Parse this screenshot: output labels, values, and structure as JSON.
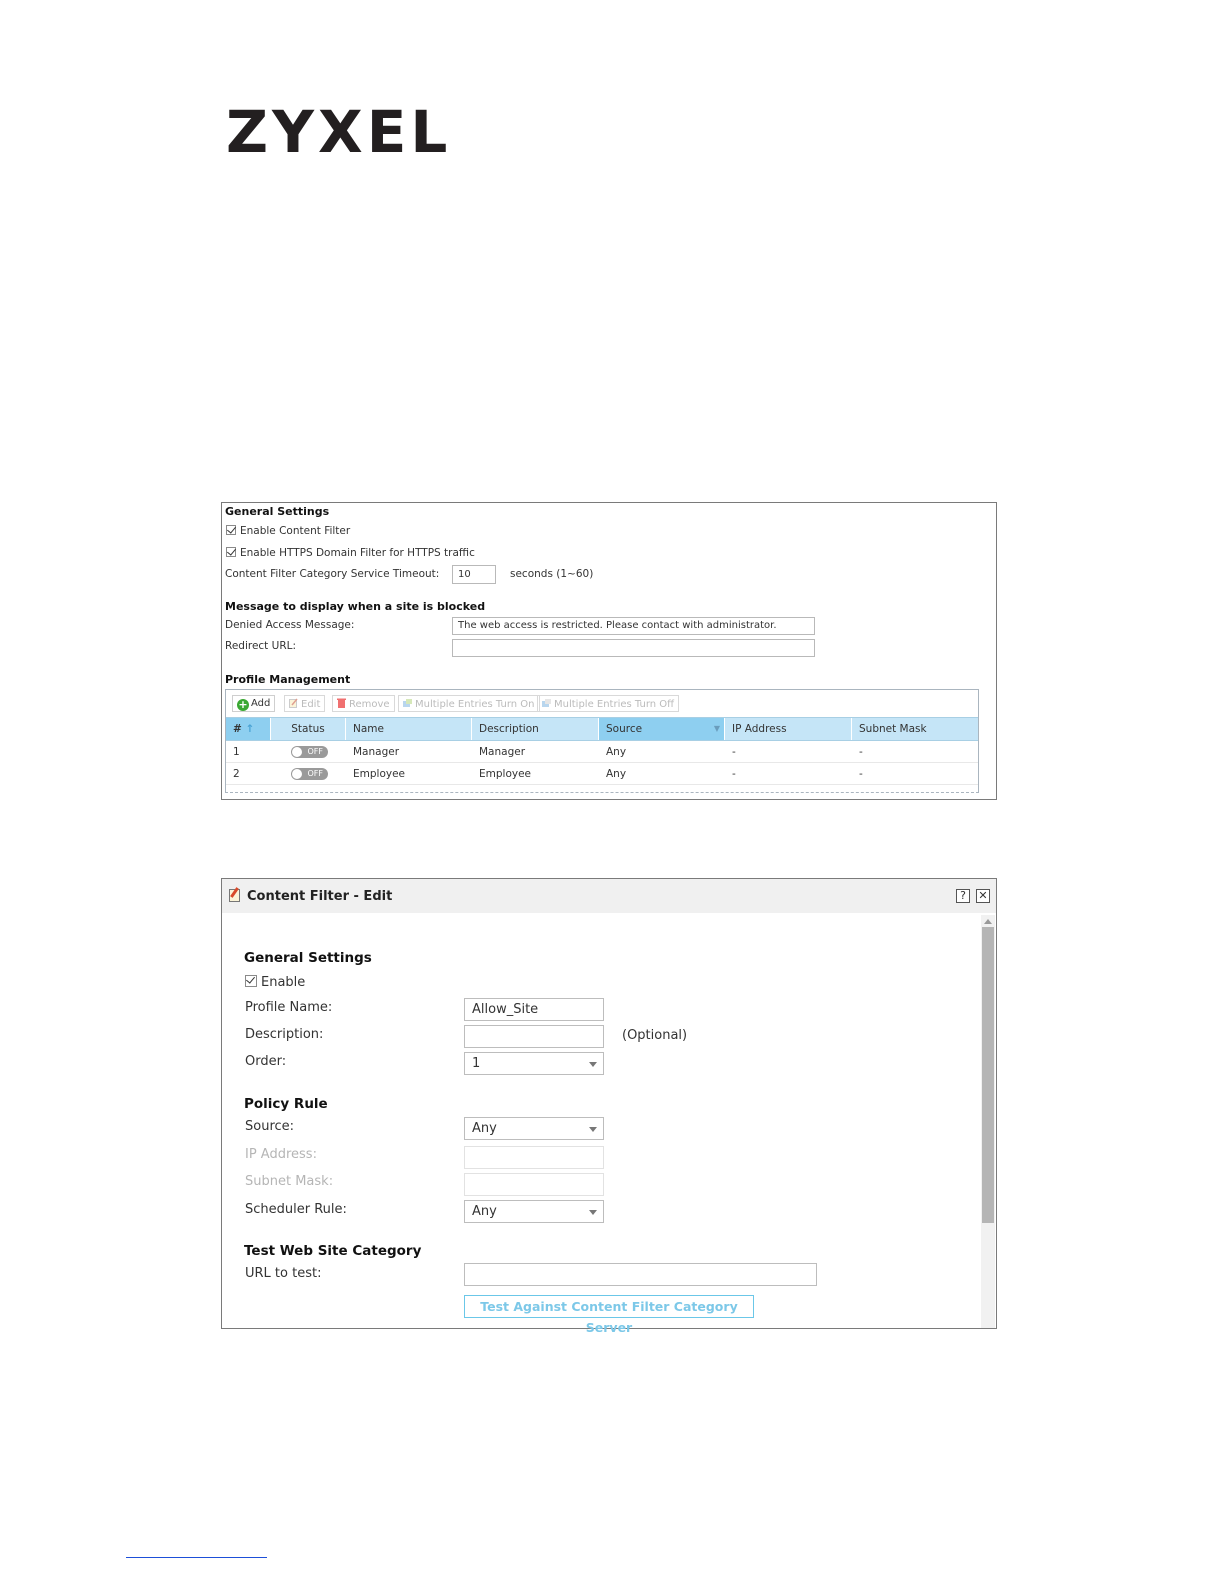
{
  "logo": {
    "text": "ZYXEL"
  },
  "panel1": {
    "general_title": "General Settings",
    "enable_content_filter": "Enable Content Filter",
    "enable_https": "Enable HTTPS Domain Filter for HTTPS traffic",
    "timeout_label": "Content Filter Category Service Timeout:",
    "timeout_value": "10",
    "timeout_unit": "seconds (1~60)",
    "message_title": "Message to display when a site is blocked",
    "denied_label": "Denied Access Message:",
    "denied_value": "The web access is restricted. Please contact with administrator.",
    "redirect_label": "Redirect URL:",
    "redirect_value": "",
    "profile_title": "Profile Management",
    "toolbar": {
      "add": "Add",
      "edit": "Edit",
      "remove": "Remove",
      "multi_on": "Multiple Entries Turn On",
      "multi_off": "Multiple Entries Turn Off"
    },
    "columns": [
      "#",
      "Status",
      "Name",
      "Description",
      "Source",
      "IP Address",
      "Subnet Mask"
    ],
    "rows": [
      {
        "num": "1",
        "status": "OFF",
        "name": "Manager",
        "description": "Manager",
        "source": "Any",
        "ip": "-",
        "mask": "-"
      },
      {
        "num": "2",
        "status": "OFF",
        "name": "Employee",
        "description": "Employee",
        "source": "Any",
        "ip": "-",
        "mask": "-"
      }
    ]
  },
  "panel2": {
    "title": "Content Filter - Edit",
    "help": "?",
    "close": "✕",
    "general_title": "General Settings",
    "enable_label": "Enable",
    "profile_name_label": "Profile Name:",
    "profile_name_value": "Allow_Site",
    "description_label": "Description:",
    "description_value": "",
    "optional": "(Optional)",
    "order_label": "Order:",
    "order_value": "1",
    "policy_title": "Policy Rule",
    "source_label": "Source:",
    "source_value": "Any",
    "ip_label": "IP Address:",
    "mask_label": "Subnet Mask:",
    "scheduler_label": "Scheduler Rule:",
    "scheduler_value": "Any",
    "test_title": "Test Web Site Category",
    "url_label": "URL to test:",
    "url_value": "",
    "test_button": "Test Against Content Filter Category Server"
  }
}
